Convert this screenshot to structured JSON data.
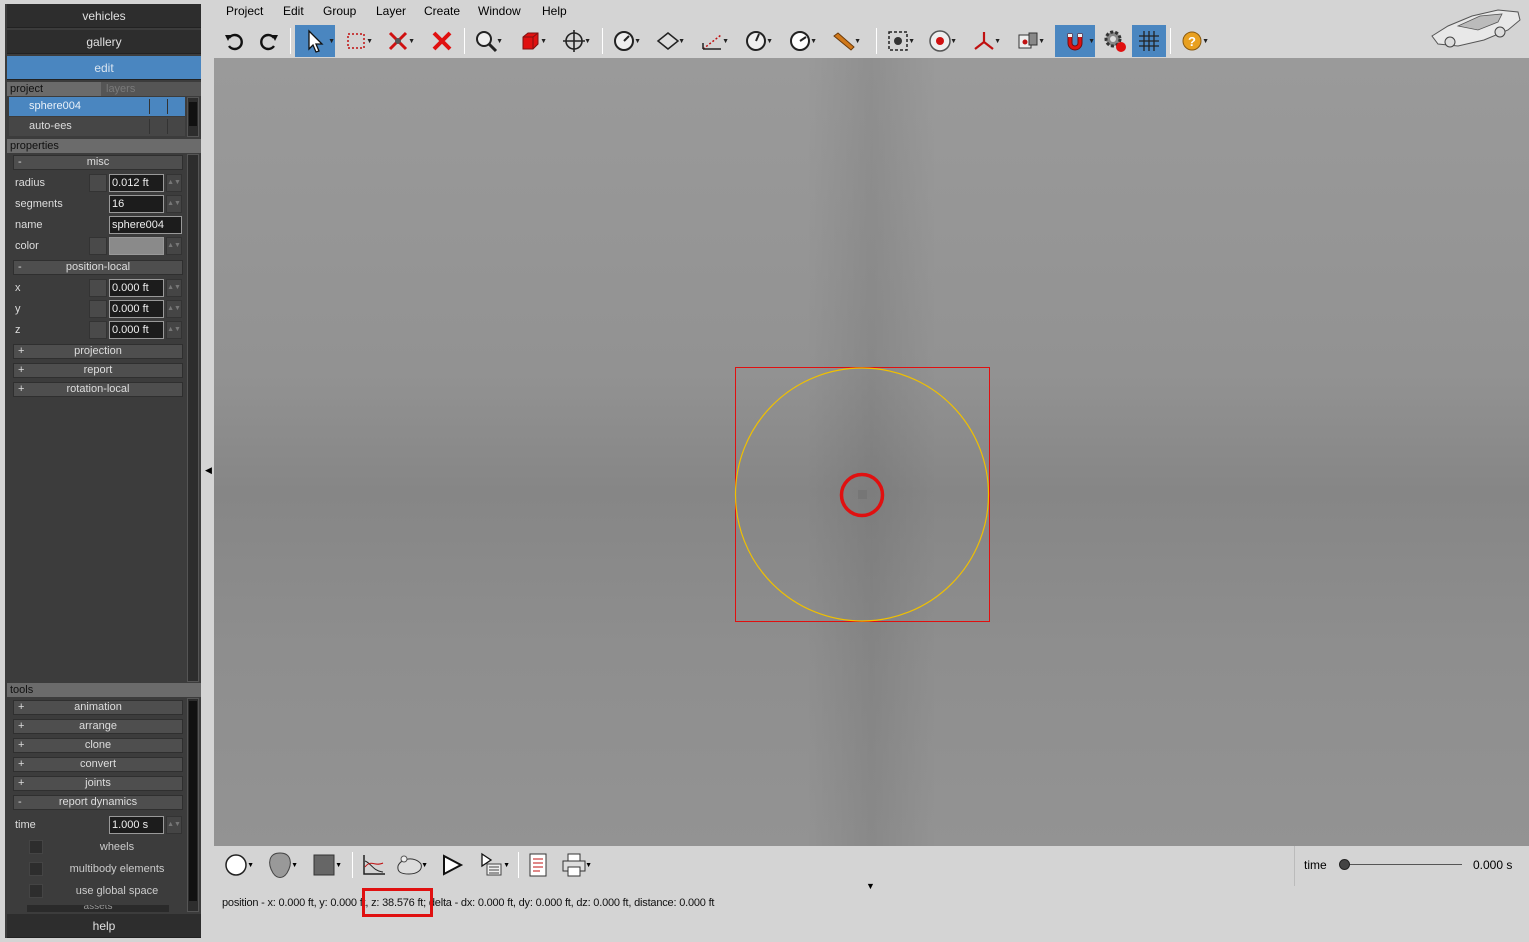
{
  "sidebar": {
    "nav": {
      "vehicles": "vehicles",
      "gallery": "gallery",
      "edit": "edit",
      "help": "help"
    },
    "project_header": {
      "project_tab": "project",
      "layers_tab": "layers"
    },
    "project_items": [
      "sphere004",
      "auto-ees"
    ],
    "properties_title": "properties",
    "misc": {
      "group_sign": "-",
      "group_label": "misc",
      "radius_label": "radius",
      "radius_value": "0.012 ft",
      "segments_label": "segments",
      "segments_value": "16",
      "name_label": "name",
      "name_value": "sphere004",
      "color_label": "color"
    },
    "position_local": {
      "group_sign": "-",
      "group_label": "position-local",
      "x_label": "x",
      "x_value": "0.000 ft",
      "y_label": "y",
      "y_value": "0.000 ft",
      "z_label": "z",
      "z_value": "0.000 ft"
    },
    "collapsed_groups": [
      {
        "sign": "+",
        "label": "projection"
      },
      {
        "sign": "+",
        "label": "report"
      },
      {
        "sign": "+",
        "label": "rotation-local"
      }
    ],
    "tools_title": "tools",
    "tool_groups": [
      {
        "sign": "+",
        "label": "animation"
      },
      {
        "sign": "+",
        "label": "arrange"
      },
      {
        "sign": "+",
        "label": "clone"
      },
      {
        "sign": "+",
        "label": "convert"
      },
      {
        "sign": "+",
        "label": "joints"
      },
      {
        "sign": "-",
        "label": "report dynamics"
      }
    ],
    "report_dynamics": {
      "time_label": "time",
      "time_value": "1.000 s",
      "wheels": "wheels",
      "multibody": "multibody elements",
      "global_space": "use global space",
      "cutoff_label": "assets"
    }
  },
  "menu": [
    "Project",
    "Edit",
    "Group",
    "Layer",
    "Create",
    "Window",
    "Help"
  ],
  "toolbar_icons": [
    "undo-icon",
    "redo-icon",
    "select-arrow-icon",
    "box-select-icon",
    "delete-constraint-icon",
    "delete-icon",
    "zoom-icon",
    "solid-cube-icon",
    "move-crosshair-icon",
    "measure-gauge-icon",
    "plane-icon",
    "dimension-ruler-icon",
    "angle-gauge-icon",
    "speed-gauge-icon",
    "pencil-icon",
    "target-frame-icon",
    "radio-target-icon",
    "axes-icon",
    "camera-icon",
    "magnet-icon",
    "settings-gear-icon",
    "grid-icon",
    "help-circle-icon"
  ],
  "colors": {
    "accent": "#4a86c0",
    "selection_box": "#e01010",
    "sphere_outline": "#f0c000",
    "highlight_circle": "#e01010"
  },
  "viewport": {
    "selected_object": "sphere004"
  },
  "timeline": {
    "label": "time",
    "value": "0.000 s",
    "slider_fraction": 0
  },
  "status": {
    "text": "position - x: 0.000 ft, y: 0.000 ft, z: 38.576 ft; delta - dx: 0.000 ft, dy: 0.000 ft, dz: 0.000 ft, distance: 0.000 ft"
  }
}
